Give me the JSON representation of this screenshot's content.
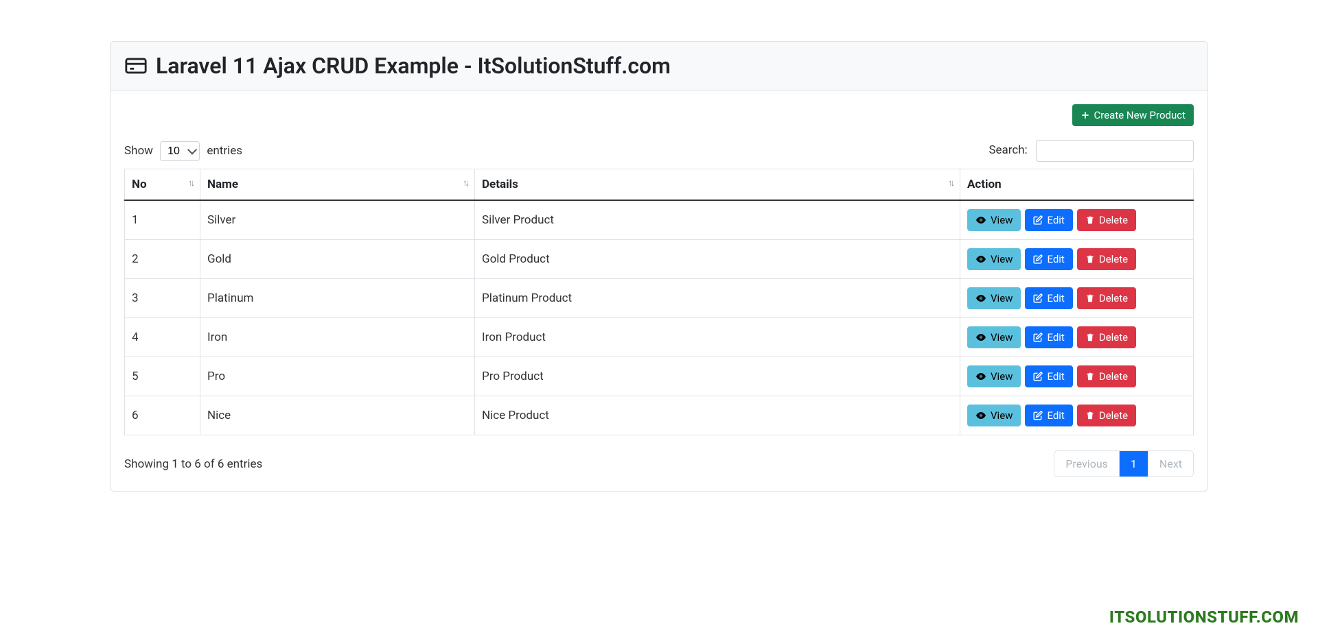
{
  "header": {
    "title": "Laravel 11 Ajax CRUD Example - ItSolutionStuff.com"
  },
  "actions": {
    "create_label": "Create New Product"
  },
  "length_control": {
    "prefix": "Show",
    "value": "10",
    "suffix": "entries"
  },
  "search": {
    "label": "Search:"
  },
  "table": {
    "columns": {
      "no": "No",
      "name": "Name",
      "details": "Details",
      "action": "Action"
    },
    "buttons": {
      "view": "View",
      "edit": "Edit",
      "delete": "Delete"
    },
    "rows": [
      {
        "no": "1",
        "name": "Silver",
        "details": "Silver Product"
      },
      {
        "no": "2",
        "name": "Gold",
        "details": "Gold Product"
      },
      {
        "no": "3",
        "name": "Platinum",
        "details": "Platinum Product"
      },
      {
        "no": "4",
        "name": "Iron",
        "details": "Iron Product"
      },
      {
        "no": "5",
        "name": "Pro",
        "details": "Pro Product"
      },
      {
        "no": "6",
        "name": "Nice",
        "details": "Nice Product"
      }
    ]
  },
  "footer": {
    "info": "Showing 1 to 6 of 6 entries",
    "pagination": {
      "previous": "Previous",
      "current": "1",
      "next": "Next"
    }
  },
  "watermark": "ITSOLUTIONSTUFF.COM"
}
